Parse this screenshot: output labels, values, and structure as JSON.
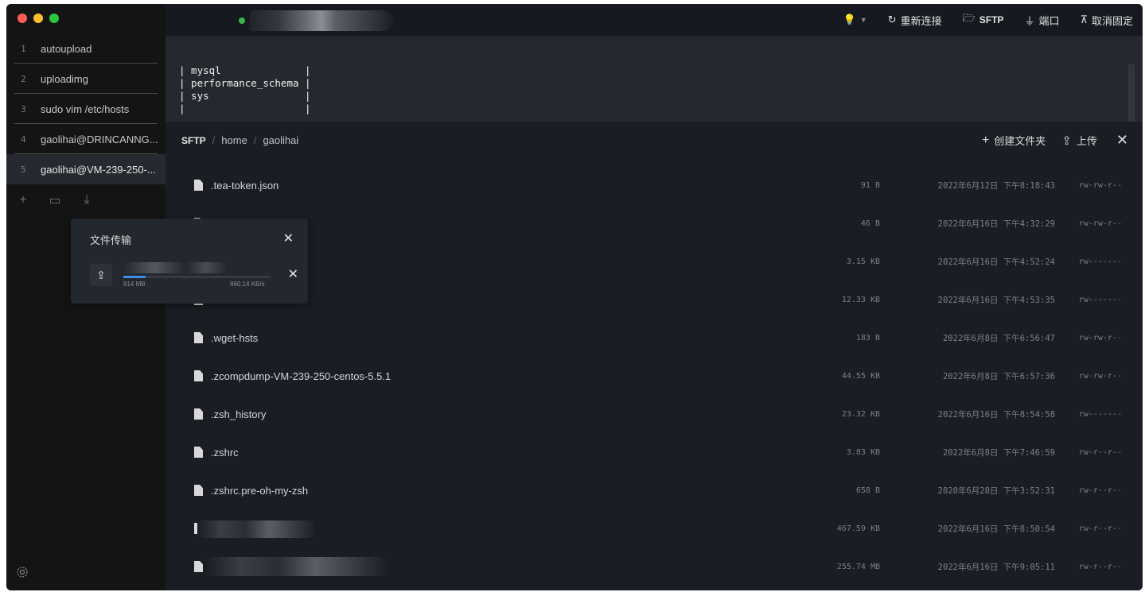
{
  "sidebar": {
    "tabs": [
      {
        "num": "1",
        "label": "autoupload"
      },
      {
        "num": "2",
        "label": "uploadimg"
      },
      {
        "num": "3",
        "label": "sudo vim /etc/hosts"
      },
      {
        "num": "4",
        "label": "gaolihai@DRINCANNG..."
      },
      {
        "num": "5",
        "label": "gaolihai@VM-239-250-..."
      }
    ],
    "actions": {
      "add": "+",
      "window": "▭",
      "download": "⤓"
    },
    "settings_icon": "gear-icon"
  },
  "topbar": {
    "theme_icon": "lightbulb-icon",
    "reconnect_label": "重新连接",
    "sftp_label": "SFTP",
    "port_label": "端口",
    "unpin_label": "取消固定"
  },
  "terminal": {
    "text": "| mysql              |\n| performance_schema |\n| sys                |\n|                    |"
  },
  "sftp": {
    "breadcrumb": {
      "root": "SFTP",
      "sep": "/",
      "path": [
        "home",
        "gaolihai"
      ]
    },
    "new_folder_label": "创建文件夹",
    "upload_label": "上传",
    "files": [
      {
        "name": ".tea-token.json",
        "size": "91 B",
        "date": "2022年6月12日 下午8:18:43",
        "perm": "rw-rw-r--"
      },
      {
        "name": "",
        "size": "46 B",
        "date": "2022年6月16日 下午4:32:29",
        "perm": "rw-rw-r--"
      },
      {
        "name": "",
        "size": "3.15 KB",
        "date": "2022年6月16日 下午4:52:24",
        "perm": "rw-------"
      },
      {
        "name": "",
        "size": "12.33 KB",
        "date": "2022年6月16日 下午4:53:35",
        "perm": "rw-------"
      },
      {
        "name": ".wget-hsts",
        "size": "183 B",
        "date": "2022年6月8日 下午6:56:47",
        "perm": "rw-rw-r--"
      },
      {
        "name": ".zcompdump-VM-239-250-centos-5.5.1",
        "size": "44.55 KB",
        "date": "2022年6月8日 下午6:57:36",
        "perm": "rw-rw-r--"
      },
      {
        "name": ".zsh_history",
        "size": "23.32 KB",
        "date": "2022年6月16日 下午8:54:58",
        "perm": "rw-------"
      },
      {
        "name": ".zshrc",
        "size": "3.83 KB",
        "date": "2022年6月8日 下午7:46:59",
        "perm": "rw-r--r--"
      },
      {
        "name": ".zshrc.pre-oh-my-zsh",
        "size": "658 B",
        "date": "2020年6月28日 下午3:52:31",
        "perm": "rw-r--r--"
      },
      {
        "name": "",
        "size": "467.59 KB",
        "date": "2022年6月16日 下午8:50:54",
        "perm": "rw-r--r--"
      },
      {
        "name": "",
        "size": "255.74 MB",
        "date": "2022年6月16日 下午9:05:11",
        "perm": "rw-r--r--"
      }
    ]
  },
  "transfer": {
    "title": "文件传输",
    "item": {
      "size": "814 MB",
      "speed": "860.14 KB/s",
      "progress": 0.15
    }
  }
}
